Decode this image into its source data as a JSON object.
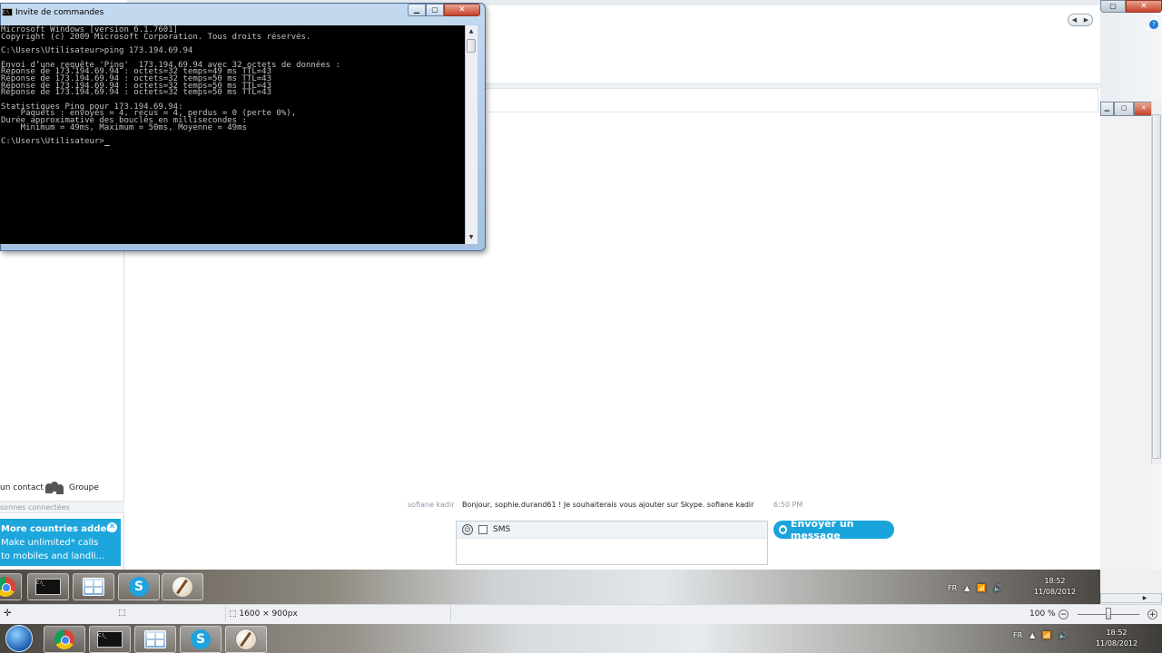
{
  "cmd": {
    "title": "Invite de commandes",
    "minimize_glyph": "▁",
    "maximize_glyph": "▢",
    "close_glyph": "✕",
    "console_lines": [
      "Microsoft Windows [version 6.1.7601]",
      "Copyright (c) 2009 Microsoft Corporation. Tous droits réservés.",
      "",
      "C:\\Users\\Utilisateur>ping 173.194.69.94",
      "",
      "Envoi d’une requête 'Ping'  173.194.69.94 avec 32 octets de données :",
      "Réponse de 173.194.69.94 : octets=32 temps=49 ms TTL=43",
      "Réponse de 173.194.69.94 : octets=32 temps=50 ms TTL=43",
      "Réponse de 173.194.69.94 : octets=32 temps=50 ms TTL=43",
      "Réponse de 173.194.69.94 : octets=32 temps=50 ms TTL=43",
      "",
      "Statistiques Ping pour 173.194.69.94:",
      "    Paquets : envoyés = 4, reçus = 4, perdus = 0 (perte 0%),",
      "Durée approximative des boucles en millisecondes :",
      "    Minimum = 49ms, Maximum = 50ms, Moyenne = 49ms",
      "",
      "C:\\Users\\Utilisateur>"
    ]
  },
  "skype": {
    "add_contact_label": "un contact",
    "group_label": "Groupe",
    "contacts_status": "sonnes connectées",
    "promo": {
      "title": "More countries added",
      "line1": "Make unlimited* calls",
      "line2": "to mobiles and landli..."
    },
    "message": {
      "sender": "sofiane kadir",
      "text": "Bonjour, sophie.durand61 ! Je souhaiterais vous ajouter sur Skype. sofiane kadir",
      "time": "6:50 PM"
    },
    "sms_label": "SMS",
    "send_button": "Envoyer un message"
  },
  "taskbar_top": {
    "lang": "FR",
    "time": "18:52",
    "date": "11/08/2012"
  },
  "statusbar": {
    "dimensions": "1600 × 900px",
    "zoom": "100 %"
  },
  "taskbar_bottom": {
    "lang": "FR",
    "time": "18:52",
    "date": "11/08/2012"
  },
  "colors": {
    "skype_blue": "#1aa4dc",
    "console_bg": "#000000",
    "console_fg": "#c0c0c0"
  }
}
